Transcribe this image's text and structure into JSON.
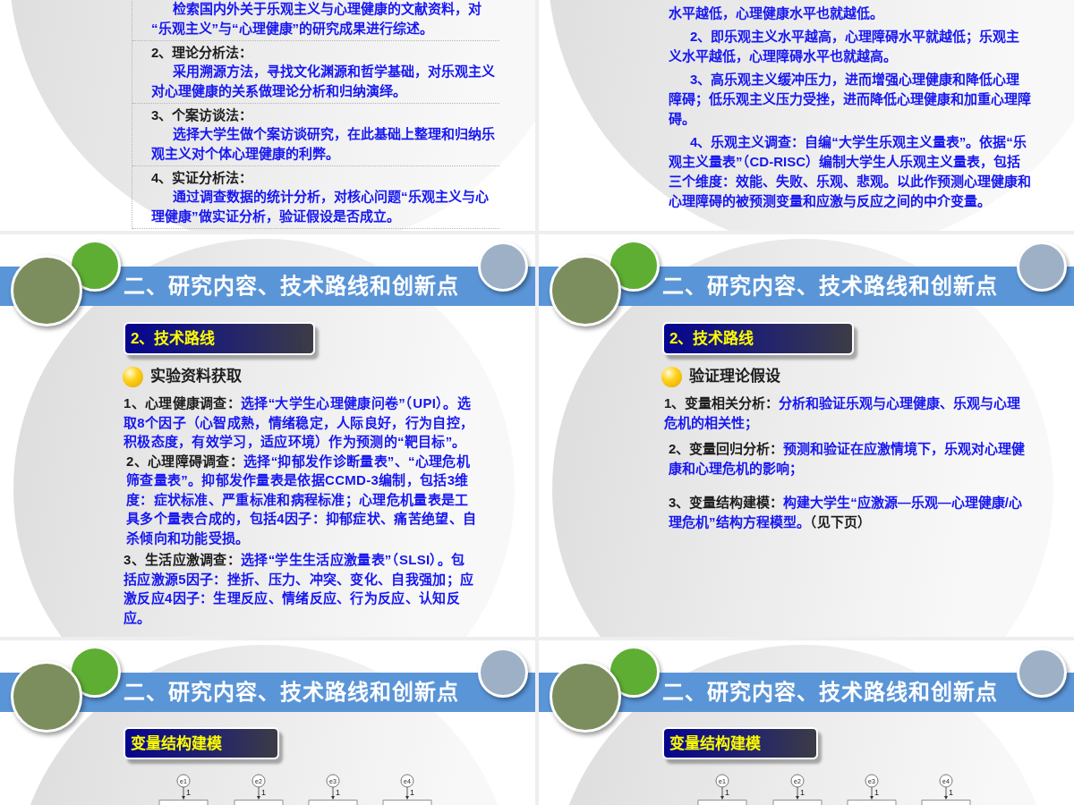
{
  "slides": [
    {
      "kind": "methods_table",
      "rows": [
        {
          "description": "检索国内外关于乐观主义与心理健康的文献资料，对“乐观主义”与“心理健康”的研究成果进行综述。"
        },
        {
          "label": "2、理论分析法：",
          "description": "采用溯源方法，寻找文化渊源和哲学基础，对乐观主义对心理健康的关系做理论分析和归纳演绎。"
        },
        {
          "label": "3、个案访谈法：",
          "description": "选择大学生做个案访谈研究，在此基础上整理和归纳乐观主义对个体心理健康的利弊。"
        },
        {
          "label": "4、实证分析法：",
          "description": "通过调查数据的统计分析，对核心问题“乐观主义与心理健康”做实证分析，验证假设是否成立。"
        }
      ]
    },
    {
      "kind": "text",
      "paragraphs": [
        {
          "text": "水平越低，心理健康水平也就越低。",
          "continued": true
        },
        {
          "text": "2、即乐观主义水平越高，心理障碍水平就越低；乐观主义水平越低，心理障碍水平也就越高。",
          "continued": false
        },
        {
          "text": "3、高乐观主义缓冲压力，进而增强心理健康和降低心理障碍；低乐观主义压力受挫，进而降低心理健康和加重心理障碍。",
          "continued": false
        },
        {
          "text": "4、乐观主义调查：自编“大学生乐观主义量表”。依据“乐观主义量表”（CD-RISC）编制大学生人乐观主义量表，包括三个维度：效能、失败、乐观、悲观。以此作预测心理健康和心理障碍的被预测变量和应激与反应之间的中介变量。",
          "continued": false
        }
      ]
    },
    {
      "kind": "content",
      "title": "二、研究内容、技术路线和创新点",
      "heading": "2、技术路线",
      "bullet": "实验资料获取",
      "items": [
        {
          "label": "1、心理健康调查：",
          "text": "选择“大学生心理健康问卷”（UPI）。选取8个因子（心智成熟，情绪稳定，人际良好，行为自控，积极态度，有效学习，适应环境）作为预测的“靶目标”。"
        },
        {
          "label": "2、心理障碍调查：",
          "text": "选择“抑郁发作诊断量表”、“心理危机筛查量表”。抑郁发作量表是依据CCMD-3编制，包括3维度：症状标准、严重标准和病程标准；心理危机量表是工具多个量表合成的，包括4因子：抑郁症状、痛苦绝望、自杀倾向和功能受损。"
        },
        {
          "label": "3、生活应激调查：",
          "text": "选择“学生生活应激量表”（SLSI）。包括应激源5因子：挫折、压力、冲突、变化、自我强加；应激反应4因子：生理反应、情绪反应、行为反应、认知反应。"
        }
      ]
    },
    {
      "kind": "content",
      "title": "二、研究内容、技术路线和创新点",
      "heading": "2、技术路线",
      "bullet": "验证理论假设",
      "items": [
        {
          "label": "1、变量相关分析：",
          "text": "分析和验证乐观与心理健康、乐观与心理危机的相关性；"
        },
        {
          "label": "2、变量回归分析：",
          "text": "预测和验证在应激情境下，乐观对心理健康和心理危机的影响；"
        },
        {
          "label": "3、变量结构建模：",
          "text": "构建大学生“应激源—乐观—心理健康/心理危机”结构方程模型。",
          "note": "（见下页）"
        }
      ]
    },
    {
      "kind": "diagram",
      "title": "二、研究内容、技术路线和创新点",
      "heading": "变量结构建模",
      "error_terms": [
        {
          "label": "e1",
          "path_label": "1"
        },
        {
          "label": "e2",
          "path_label": "1"
        },
        {
          "label": "e3",
          "path_label": "1"
        },
        {
          "label": "e4",
          "path_label": "1"
        }
      ]
    },
    {
      "kind": "diagram",
      "title": "二、研究内容、技术路线和创新点",
      "heading": "变量结构建模",
      "error_terms": [
        {
          "label": "e1",
          "path_label": "1"
        },
        {
          "label": "e2",
          "path_label": "1"
        },
        {
          "label": "e3",
          "path_label": "1"
        },
        {
          "label": "e4",
          "path_label": "1"
        }
      ]
    }
  ]
}
